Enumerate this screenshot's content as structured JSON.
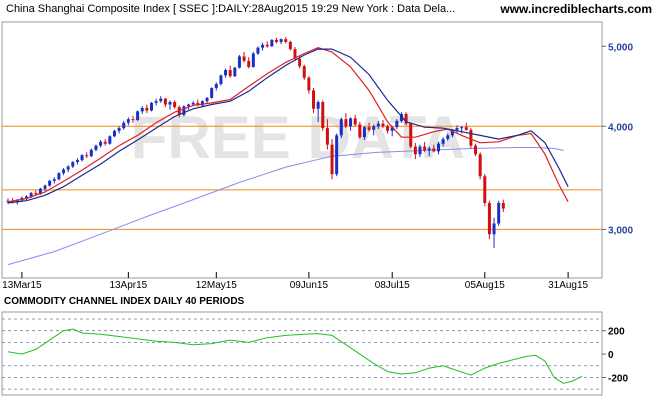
{
  "header": {
    "title": "China Shanghai Composite Index [ SSEC ]:DAILY:28Aug2015 19:29 New York : Data Dela...",
    "site": "www.incrediblecharts.com"
  },
  "watermark": "FREE DATA",
  "colors": {
    "candle_up": "#1a2fc7",
    "candle_down": "#d01010",
    "fast_ma": "#e02020",
    "slow_ma": "#1a2a8f",
    "long_ma": "#8a8af0",
    "horizontal_lines": "#f08a1c",
    "cci_line": "#22c022",
    "axis_label": "#2b3f9e"
  },
  "chart_data": [
    {
      "type": "candlestick",
      "y_ticks": [
        {
          "value": 3000,
          "label": "3,000"
        },
        {
          "value": 4000,
          "label": "4,000"
        },
        {
          "value": 5000,
          "label": "5,000"
        }
      ],
      "x_ticks": [
        {
          "index": 3,
          "label": "13Mar15"
        },
        {
          "index": 26,
          "label": "13Apr15"
        },
        {
          "index": 45,
          "label": "12May15"
        },
        {
          "index": 65,
          "label": "09Jun15"
        },
        {
          "index": 83,
          "label": "08Jul15"
        },
        {
          "index": 103,
          "label": "05Aug15"
        },
        {
          "index": 121,
          "label": "31Aug15"
        }
      ],
      "horizontal_levels": [
        3350,
        3000,
        4000
      ],
      "ylim": [
        2620,
        5350
      ],
      "series": [
        {
          "name": "",
          "style": "fast_ma",
          "values": [
            [
              0,
              3240
            ],
            [
              4,
              3270
            ],
            [
              8,
              3330
            ],
            [
              12,
              3430
            ],
            [
              16,
              3540
            ],
            [
              20,
              3660
            ],
            [
              24,
              3790
            ],
            [
              28,
              3900
            ],
            [
              32,
              4040
            ],
            [
              36,
              4160
            ],
            [
              40,
              4240
            ],
            [
              44,
              4270
            ],
            [
              48,
              4310
            ],
            [
              52,
              4470
            ],
            [
              56,
              4630
            ],
            [
              60,
              4780
            ],
            [
              64,
              4900
            ],
            [
              67,
              4980
            ],
            [
              70,
              4920
            ],
            [
              74,
              4720
            ],
            [
              78,
              4420
            ],
            [
              82,
              4050
            ],
            [
              85,
              3880
            ],
            [
              88,
              3880
            ],
            [
              92,
              3940
            ],
            [
              95,
              3970
            ],
            [
              98,
              3900
            ],
            [
              102,
              3820
            ],
            [
              106,
              3830
            ],
            [
              110,
              3900
            ],
            [
              113,
              3920
            ],
            [
              116,
              3700
            ],
            [
              119,
              3400
            ],
            [
              121,
              3240
            ]
          ]
        },
        {
          "name": "",
          "style": "slow_ma",
          "values": [
            [
              0,
              3230
            ],
            [
              4,
              3250
            ],
            [
              8,
              3300
            ],
            [
              12,
              3380
            ],
            [
              16,
              3490
            ],
            [
              20,
              3600
            ],
            [
              24,
              3730
            ],
            [
              28,
              3850
            ],
            [
              32,
              3980
            ],
            [
              36,
              4110
            ],
            [
              40,
              4200
            ],
            [
              44,
              4250
            ],
            [
              48,
              4290
            ],
            [
              52,
              4410
            ],
            [
              56,
              4580
            ],
            [
              60,
              4740
            ],
            [
              64,
              4880
            ],
            [
              67,
              4960
            ],
            [
              70,
              4960
            ],
            [
              74,
              4850
            ],
            [
              78,
              4620
            ],
            [
              82,
              4300
            ],
            [
              86,
              4050
            ],
            [
              90,
              3990
            ],
            [
              94,
              3980
            ],
            [
              98,
              3940
            ],
            [
              102,
              3900
            ],
            [
              106,
              3860
            ],
            [
              110,
              3900
            ],
            [
              113,
              3950
            ],
            [
              116,
              3820
            ],
            [
              119,
              3560
            ],
            [
              121,
              3380
            ]
          ]
        },
        {
          "name": "",
          "style": "long_ma",
          "values": [
            [
              0,
              2720
            ],
            [
              10,
              2820
            ],
            [
              20,
              2960
            ],
            [
              30,
              3110
            ],
            [
              40,
              3260
            ],
            [
              50,
              3420
            ],
            [
              60,
              3570
            ],
            [
              70,
              3680
            ],
            [
              80,
              3720
            ],
            [
              90,
              3740
            ],
            [
              100,
              3760
            ],
            [
              110,
              3770
            ],
            [
              114,
              3770
            ],
            [
              118,
              3760
            ],
            [
              120,
              3740
            ]
          ]
        }
      ],
      "candles": [
        [
          3240,
          3270,
          3220,
          3250
        ],
        [
          3250,
          3275,
          3225,
          3235
        ],
        [
          3235,
          3265,
          3215,
          3255
        ],
        [
          3255,
          3290,
          3240,
          3275
        ],
        [
          3275,
          3300,
          3255,
          3290
        ],
        [
          3290,
          3330,
          3275,
          3320
        ],
        [
          3320,
          3345,
          3300,
          3310
        ],
        [
          3310,
          3370,
          3305,
          3360
        ],
        [
          3360,
          3400,
          3340,
          3390
        ],
        [
          3390,
          3445,
          3380,
          3435
        ],
        [
          3435,
          3470,
          3410,
          3450
        ],
        [
          3450,
          3520,
          3440,
          3510
        ],
        [
          3510,
          3560,
          3490,
          3545
        ],
        [
          3545,
          3590,
          3520,
          3575
        ],
        [
          3575,
          3630,
          3560,
          3620
        ],
        [
          3620,
          3660,
          3595,
          3640
        ],
        [
          3640,
          3700,
          3625,
          3690
        ],
        [
          3690,
          3720,
          3660,
          3680
        ],
        [
          3680,
          3760,
          3670,
          3745
        ],
        [
          3745,
          3800,
          3730,
          3790
        ],
        [
          3790,
          3850,
          3770,
          3830
        ],
        [
          3830,
          3860,
          3790,
          3810
        ],
        [
          3810,
          3900,
          3800,
          3890
        ],
        [
          3890,
          3960,
          3880,
          3950
        ],
        [
          3950,
          4000,
          3920,
          3980
        ],
        [
          3980,
          4060,
          3960,
          4040
        ],
        [
          4040,
          4100,
          4010,
          4080
        ],
        [
          4080,
          4120,
          4040,
          4070
        ],
        [
          4070,
          4180,
          4060,
          4170
        ],
        [
          4170,
          4230,
          4140,
          4210
        ],
        [
          4210,
          4250,
          4150,
          4180
        ],
        [
          4180,
          4280,
          4170,
          4270
        ],
        [
          4270,
          4320,
          4240,
          4290
        ],
        [
          4290,
          4350,
          4270,
          4320
        ],
        [
          4320,
          4330,
          4220,
          4250
        ],
        [
          4250,
          4300,
          4190,
          4280
        ],
        [
          4280,
          4300,
          4200,
          4220
        ],
        [
          4220,
          4240,
          4100,
          4130
        ],
        [
          4130,
          4240,
          4110,
          4230
        ],
        [
          4230,
          4260,
          4190,
          4250
        ],
        [
          4250,
          4290,
          4230,
          4270
        ],
        [
          4270,
          4310,
          4230,
          4240
        ],
        [
          4240,
          4300,
          4220,
          4290
        ],
        [
          4290,
          4340,
          4260,
          4330
        ],
        [
          4330,
          4460,
          4320,
          4450
        ],
        [
          4450,
          4520,
          4420,
          4500
        ],
        [
          4500,
          4620,
          4480,
          4610
        ],
        [
          4610,
          4700,
          4580,
          4680
        ],
        [
          4680,
          4740,
          4580,
          4600
        ],
        [
          4600,
          4720,
          4590,
          4710
        ],
        [
          4710,
          4880,
          4700,
          4860
        ],
        [
          4860,
          4920,
          4780,
          4800
        ],
        [
          4800,
          4850,
          4700,
          4720
        ],
        [
          4720,
          4920,
          4710,
          4900
        ],
        [
          4900,
          5000,
          4880,
          4980
        ],
        [
          4980,
          5050,
          4940,
          5020
        ],
        [
          5020,
          5070,
          4980,
          5000
        ],
        [
          5000,
          5100,
          4990,
          5090
        ],
        [
          5090,
          5120,
          5040,
          5060
        ],
        [
          5060,
          5110,
          5030,
          5100
        ],
        [
          5100,
          5130,
          5040,
          5060
        ],
        [
          5060,
          5080,
          4940,
          4960
        ],
        [
          4960,
          4990,
          4800,
          4830
        ],
        [
          4830,
          4870,
          4700,
          4730
        ],
        [
          4730,
          4750,
          4550,
          4580
        ],
        [
          4580,
          4600,
          4380,
          4420
        ],
        [
          4420,
          4450,
          4150,
          4200
        ],
        [
          4200,
          4300,
          4050,
          4280
        ],
        [
          4280,
          4300,
          3950,
          3980
        ],
        [
          3980,
          4080,
          3750,
          3800
        ],
        [
          3800,
          3860,
          3450,
          3500
        ],
        [
          3500,
          3920,
          3480,
          3900
        ],
        [
          3900,
          4100,
          3870,
          4080
        ],
        [
          4080,
          4150,
          3980,
          4000
        ],
        [
          4000,
          4100,
          3950,
          4090
        ],
        [
          4090,
          4130,
          4000,
          4020
        ],
        [
          4020,
          4050,
          3860,
          3880
        ],
        [
          3880,
          4000,
          3850,
          3990
        ],
        [
          3990,
          4040,
          3940,
          3960
        ],
        [
          3960,
          4020,
          3900,
          4000
        ],
        [
          4000,
          4060,
          3970,
          4030
        ],
        [
          4030,
          4070,
          3980,
          4000
        ],
        [
          4000,
          4020,
          3920,
          3950
        ],
        [
          3950,
          4000,
          3890,
          3990
        ],
        [
          3990,
          4080,
          3970,
          4060
        ],
        [
          4060,
          4160,
          4040,
          4140
        ],
        [
          4140,
          4160,
          4010,
          4030
        ],
        [
          4030,
          4040,
          3760,
          3780
        ],
        [
          3780,
          3820,
          3650,
          3700
        ],
        [
          3700,
          3800,
          3670,
          3780
        ],
        [
          3780,
          3830,
          3720,
          3740
        ],
        [
          3740,
          3780,
          3680,
          3760
        ],
        [
          3760,
          3800,
          3720,
          3730
        ],
        [
          3730,
          3830,
          3700,
          3810
        ],
        [
          3810,
          3880,
          3780,
          3860
        ],
        [
          3860,
          3920,
          3840,
          3900
        ],
        [
          3900,
          3970,
          3880,
          3960
        ],
        [
          3960,
          4010,
          3930,
          3980
        ],
        [
          3980,
          4000,
          3920,
          3990
        ],
        [
          3990,
          4040,
          3950,
          3960
        ],
        [
          3960,
          3980,
          3760,
          3790
        ],
        [
          3790,
          3810,
          3680,
          3700
        ],
        [
          3700,
          3720,
          3450,
          3480
        ],
        [
          3480,
          3500,
          3200,
          3230
        ],
        [
          3230,
          3250,
          2920,
          2960
        ],
        [
          2960,
          3100,
          2850,
          3050
        ],
        [
          3050,
          3250,
          3030,
          3230
        ],
        [
          3230,
          3260,
          3150,
          3180
        ]
      ],
      "candles_start_index": 0
    },
    {
      "type": "line",
      "title": "COMMODITY CHANNEL INDEX DAILY 40 PERIODS",
      "y_ticks": [
        {
          "value": 200,
          "label": "200"
        },
        {
          "value": 0,
          "label": "0"
        },
        {
          "value": -200,
          "label": "-200"
        }
      ],
      "dashed_levels": [
        300,
        200,
        100,
        -100,
        -200,
        -300
      ],
      "ylim": [
        -350,
        360
      ],
      "values": [
        [
          0,
          20
        ],
        [
          3,
          0
        ],
        [
          6,
          40
        ],
        [
          9,
          120
        ],
        [
          12,
          200
        ],
        [
          14,
          215
        ],
        [
          16,
          180
        ],
        [
          20,
          170
        ],
        [
          24,
          150
        ],
        [
          28,
          130
        ],
        [
          32,
          110
        ],
        [
          36,
          100
        ],
        [
          40,
          80
        ],
        [
          44,
          90
        ],
        [
          48,
          120
        ],
        [
          52,
          100
        ],
        [
          56,
          140
        ],
        [
          60,
          160
        ],
        [
          64,
          170
        ],
        [
          67,
          175
        ],
        [
          70,
          160
        ],
        [
          73,
          80
        ],
        [
          76,
          0
        ],
        [
          79,
          -80
        ],
        [
          82,
          -150
        ],
        [
          85,
          -170
        ],
        [
          88,
          -160
        ],
        [
          91,
          -120
        ],
        [
          94,
          -100
        ],
        [
          97,
          -140
        ],
        [
          100,
          -180
        ],
        [
          103,
          -120
        ],
        [
          106,
          -80
        ],
        [
          109,
          -50
        ],
        [
          112,
          -20
        ],
        [
          114,
          -10
        ],
        [
          116,
          -60
        ],
        [
          118,
          -200
        ],
        [
          120,
          -250
        ],
        [
          122,
          -230
        ],
        [
          124,
          -190
        ]
      ]
    }
  ]
}
